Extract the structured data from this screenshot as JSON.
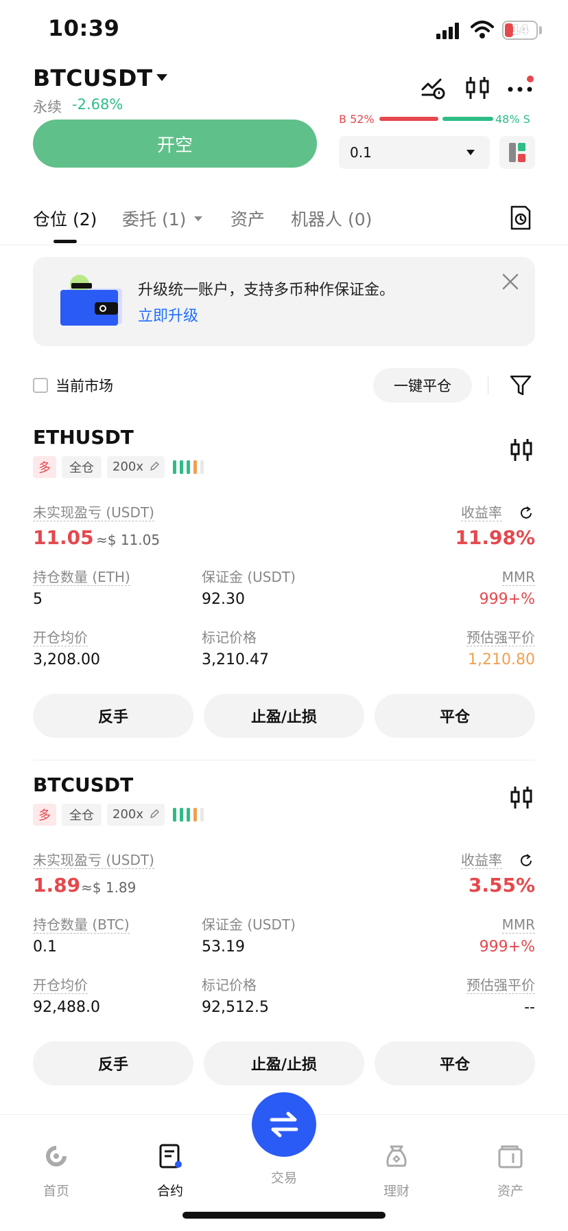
{
  "status_bar": {
    "time": "10:39",
    "battery": "14"
  },
  "header": {
    "pair": "BTCUSDT",
    "contract_type": "永续",
    "change": "-2.68%",
    "buy_ratio": "B 52%",
    "sell_ratio": "48% S",
    "open_short": "开空",
    "quantity": "0.1"
  },
  "tabs": [
    {
      "label": "仓位 (2)"
    },
    {
      "label": "委托 (1)"
    },
    {
      "label": "资产"
    },
    {
      "label": "机器人 (0)"
    }
  ],
  "banner": {
    "text": "升级统一账户，支持多币种作保证金。",
    "link": "立即升级"
  },
  "filter": {
    "current_market": "当前市场",
    "close_all": "一键平仓"
  },
  "positions": [
    {
      "symbol": "ETHUSDT",
      "side": "多",
      "margin_mode": "全仓",
      "leverage": "200x",
      "pnl_label": "未实现盈亏 (USDT)",
      "pnl": "11.05",
      "pnl_approx": "≈$ 11.05",
      "roi_label": "收益率",
      "roi": "11.98%",
      "size_label": "持仓数量 (ETH)",
      "size": "5",
      "margin_label": "保证金 (USDT)",
      "margin": "92.30",
      "mmr_label": "MMR",
      "mmr": "999+%",
      "entry_label": "开仓均价",
      "entry": "3,208.00",
      "mark_label": "标记价格",
      "mark": "3,210.47",
      "liq_label": "预估强平价",
      "liq": "1,210.80",
      "btn_reverse": "反手",
      "btn_tpsl": "止盈/止损",
      "btn_close": "平仓"
    },
    {
      "symbol": "BTCUSDT",
      "side": "多",
      "margin_mode": "全仓",
      "leverage": "200x",
      "pnl_label": "未实现盈亏 (USDT)",
      "pnl": "1.89",
      "pnl_approx": "≈$ 1.89",
      "roi_label": "收益率",
      "roi": "3.55%",
      "size_label": "持仓数量 (BTC)",
      "size": "0.1",
      "margin_label": "保证金 (USDT)",
      "margin": "53.19",
      "mmr_label": "MMR",
      "mmr": "999+%",
      "entry_label": "开仓均价",
      "entry": "92,488.0",
      "mark_label": "标记价格",
      "mark": "92,512.5",
      "liq_label": "预估强平价",
      "liq": "--",
      "btn_reverse": "反手",
      "btn_tpsl": "止盈/止损",
      "btn_close": "平仓"
    }
  ],
  "bottom_nav": [
    {
      "label": "首页",
      "icon": "home-icon"
    },
    {
      "label": "合约",
      "icon": "contract-icon"
    },
    {
      "label": "交易",
      "icon": "swap-icon"
    },
    {
      "label": "理财",
      "icon": "finance-icon"
    },
    {
      "label": "资产",
      "icon": "wallet-icon"
    }
  ],
  "colors": {
    "green": "#2ebd85",
    "red": "#e5484d",
    "open_short_bg": "#5fc089",
    "accent_blue": "#2a5bf5",
    "link_blue": "#1f6fff",
    "orange": "#f0a050"
  }
}
